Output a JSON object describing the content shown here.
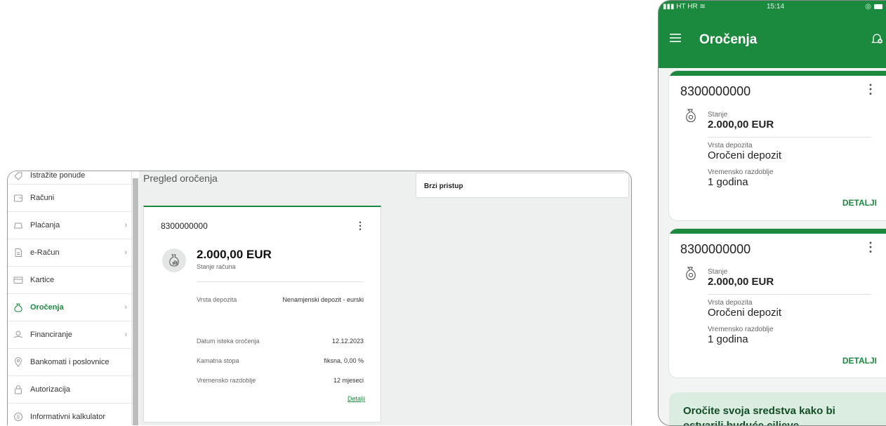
{
  "desktop": {
    "sidebar": {
      "items": [
        {
          "label": "Istražite ponude",
          "icon": "tag-icon",
          "chevron": false,
          "active": false
        },
        {
          "label": "Računi",
          "icon": "wallet-icon",
          "chevron": false,
          "active": false
        },
        {
          "label": "Plaćanja",
          "icon": "payment-icon",
          "chevron": true,
          "active": false
        },
        {
          "label": "e-Račun",
          "icon": "document-icon",
          "chevron": true,
          "active": false
        },
        {
          "label": "Kartice",
          "icon": "card-icon",
          "chevron": false,
          "active": false
        },
        {
          "label": "Oročenja",
          "icon": "moneybag-icon",
          "chevron": true,
          "active": true
        },
        {
          "label": "Financiranje",
          "icon": "finance-icon",
          "chevron": true,
          "active": false
        },
        {
          "label": "Bankomati i poslovnice",
          "icon": "location-icon",
          "chevron": false,
          "active": false
        },
        {
          "label": "Autorizacija",
          "icon": "lock-icon",
          "chevron": false,
          "active": false
        },
        {
          "label": "Informativni kalkulator",
          "icon": "calculator-icon",
          "chevron": false,
          "active": false
        }
      ],
      "chevron_glyph": "›"
    },
    "page_title": "Pregled oročenja",
    "quick_access": "Brzi pristup",
    "deposit_card": {
      "account": "8300000000",
      "menu_glyph": "⋮",
      "amount": "2.000,00 EUR",
      "amount_label": "Stanje računa",
      "rows": [
        {
          "label": "Vrsta depozita",
          "value": "Nenamjenski depozit - eurski"
        },
        {
          "label": "Datum isteka oročenja",
          "value": "12.12.2023"
        },
        {
          "label": "Kamatna stopa",
          "value": "fiksna, 0,00 %"
        },
        {
          "label": "Vremensko razdoblje",
          "value": "12 mjeseci"
        }
      ],
      "details_link": "Detalji"
    }
  },
  "phone": {
    "status": {
      "carrier": "HT HR",
      "time": "15:14"
    },
    "title": "Oročenja",
    "cards": [
      {
        "account": "8300000000",
        "menu_glyph": "⋮",
        "balance_label": "Stanje",
        "balance": "2.000,00 EUR",
        "type_label": "Vrsta depozita",
        "type": "Oročeni depozit",
        "period_label": "Vremensko razdoblje",
        "period": "1 godina",
        "details": "DETALJI"
      },
      {
        "account": "8300000000",
        "menu_glyph": "⋮",
        "balance_label": "Stanje",
        "balance": "2.000,00 EUR",
        "type_label": "Vrsta depozita",
        "type": "Oročeni depozit",
        "period_label": "Vremensko razdoblje",
        "period": "1 godina",
        "details": "DETALJI"
      }
    ],
    "promo": "Oročite svoja sredstva kako bi ostvarili buduće ciljeve"
  },
  "colors": {
    "brand_green": "#1b8a3e",
    "promo_bg": "#dbece0",
    "content_bg": "#eef0f0"
  }
}
